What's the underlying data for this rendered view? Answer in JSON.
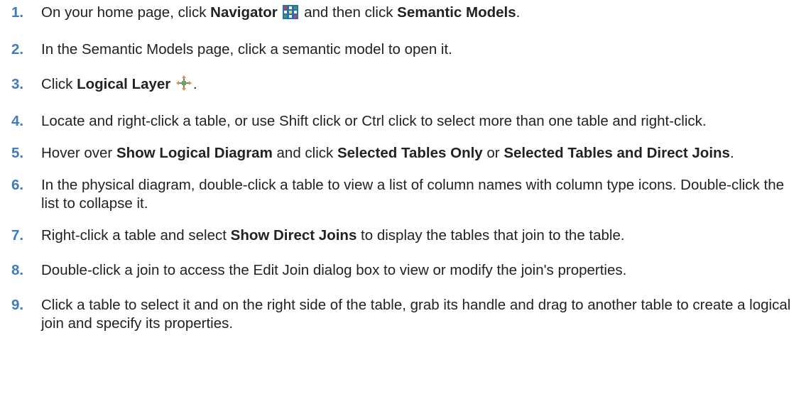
{
  "steps": [
    {
      "number": "1.",
      "parts": {
        "t1": "On your home page, click ",
        "b1": "Navigator",
        "t2": " and then click ",
        "b2": "Semantic Models",
        "t3": "."
      },
      "icon": "grid-menu-icon"
    },
    {
      "number": "2.",
      "parts": {
        "t1": "In the Semantic Models page, click a semantic model to open it."
      }
    },
    {
      "number": "3.",
      "parts": {
        "t1": "Click ",
        "b1": "Logical Layer",
        "t2": "."
      },
      "icon": "four-way-arrows-icon"
    },
    {
      "number": "4.",
      "parts": {
        "t1": "Locate and right-click a table, or use Shift click or Ctrl click to select more than one table and right-click."
      }
    },
    {
      "number": "5.",
      "parts": {
        "t1": "Hover over ",
        "b1": "Show Logical Diagram",
        "t2": " and click ",
        "b2": "Selected Tables Only",
        "t3": " or ",
        "b3": "Selected Tables and Direct Joins",
        "t4": "."
      }
    },
    {
      "number": "6.",
      "parts": {
        "t1": "In the physical diagram, double-click a table to view a list of column names with column type icons. Double-click the list to collapse it."
      }
    },
    {
      "number": "7.",
      "parts": {
        "t1": "Right-click a table and select ",
        "b1": "Show Direct Joins",
        "t2": " to display the tables that join to the table."
      }
    },
    {
      "number": "8.",
      "parts": {
        "t1": "Double-click a join to access the Edit Join dialog box to view or modify the join's properties."
      }
    },
    {
      "number": "9.",
      "parts": {
        "t1": "Click a table to select it and on the right side of the table, grab its handle and drag to another table to create a logical join and specify its properties."
      }
    }
  ],
  "colors": {
    "number": "#3b7cc4",
    "text": "#222222"
  }
}
